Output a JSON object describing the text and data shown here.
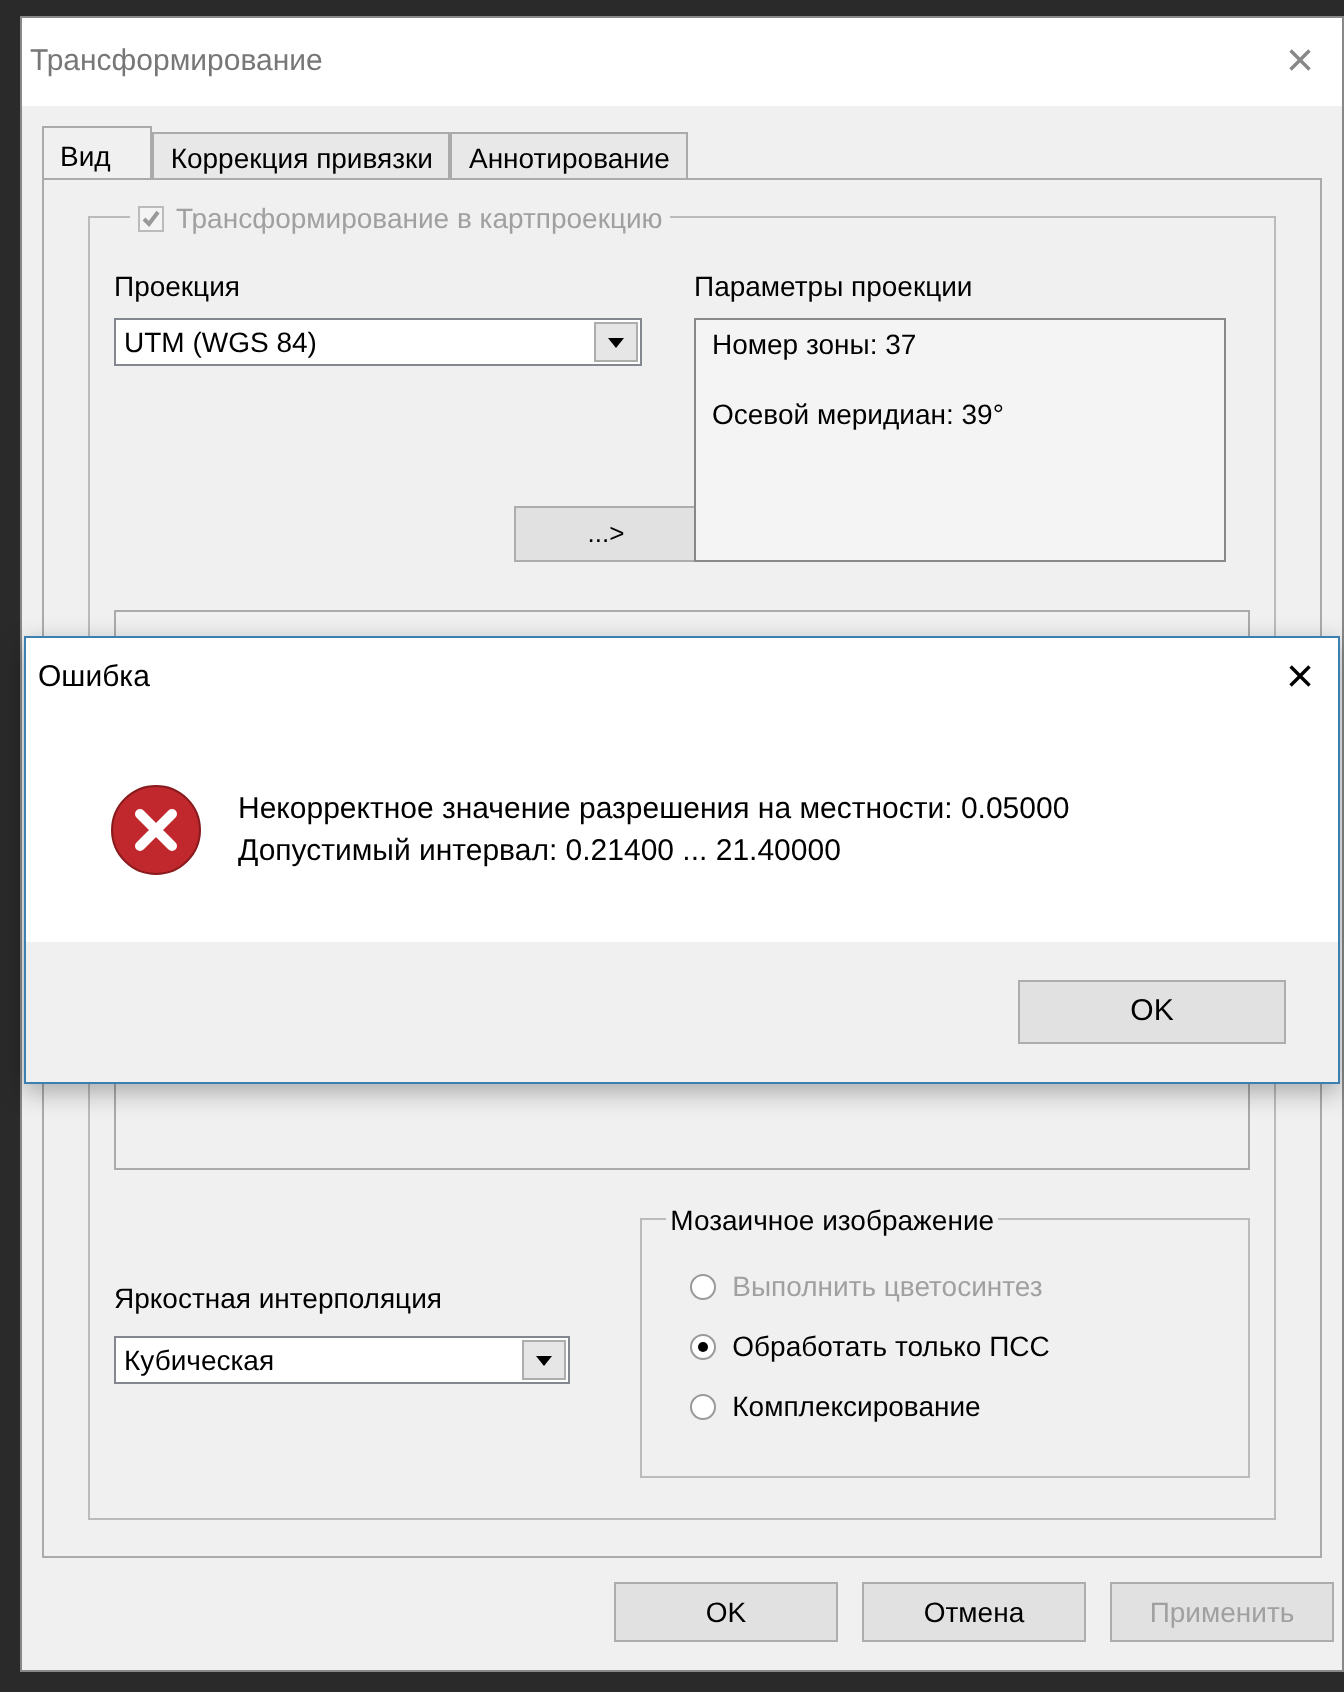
{
  "window": {
    "title": "Трансформирование",
    "close": "×"
  },
  "tabs": [
    {
      "label": "Вид",
      "selected": true
    },
    {
      "label": "Коррекция привязки",
      "selected": false
    },
    {
      "label": "Аннотирование",
      "selected": false
    }
  ],
  "transform_group": {
    "label": "Трансформирование в картпроекцию",
    "checked": true,
    "disabled": true
  },
  "projection": {
    "label": "Проекция",
    "value": "UTM (WGS 84)"
  },
  "projection_params": {
    "label": "Параметры проекции",
    "lines": [
      "Номер зоны: 37",
      "Осевой меридиан: 39°"
    ]
  },
  "more_button": "...>",
  "interpolation": {
    "label": "Яркостная интерполяция",
    "value": "Кубическая"
  },
  "mosaic": {
    "label": "Мозаичное изображение",
    "options": [
      {
        "label": "Выполнить цветосинтез",
        "selected": false,
        "disabled": true
      },
      {
        "label": "Обработать только ПСС",
        "selected": true,
        "disabled": false
      },
      {
        "label": "Комплексирование",
        "selected": false,
        "disabled": false
      }
    ]
  },
  "buttons": [
    {
      "label": "OK",
      "disabled": false
    },
    {
      "label": "Отмена",
      "disabled": false
    },
    {
      "label": "Применить",
      "disabled": true
    }
  ],
  "error_dialog": {
    "title": "Ошибка",
    "close": "×",
    "lines": [
      "Некорректное значение разрешения на местности: 0.05000",
      "Допустимый интервал: 0.21400 ... 21.40000"
    ],
    "button": "OK"
  }
}
